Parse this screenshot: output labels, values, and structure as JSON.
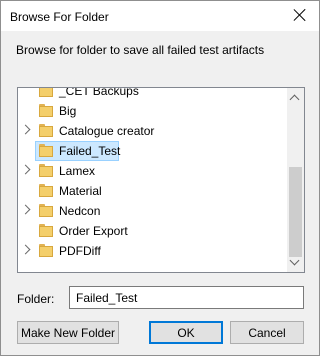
{
  "dialog": {
    "title": "Browse For Folder",
    "description": "Browse for folder to save all failed test artifacts"
  },
  "tree": {
    "items": [
      {
        "label": "_CET Backups",
        "expandable": false,
        "selected": false
      },
      {
        "label": "Big",
        "expandable": false,
        "selected": false
      },
      {
        "label": "Catalogue creator",
        "expandable": true,
        "selected": false
      },
      {
        "label": "Failed_Test",
        "expandable": false,
        "selected": true
      },
      {
        "label": "Lamex",
        "expandable": true,
        "selected": false
      },
      {
        "label": "Material",
        "expandable": false,
        "selected": false
      },
      {
        "label": "Nedcon",
        "expandable": true,
        "selected": false
      },
      {
        "label": "Order Export",
        "expandable": false,
        "selected": false
      },
      {
        "label": "PDFDiff",
        "expandable": true,
        "selected": false
      }
    ]
  },
  "folder_field": {
    "label": "Folder:",
    "value": "Failed_Test"
  },
  "buttons": {
    "new_folder": "Make New Folder",
    "ok": "OK",
    "cancel": "Cancel"
  },
  "colors": {
    "selection_bg": "#cce8ff",
    "selection_border": "#99d1ff",
    "default_button_border": "#0078d7",
    "folder_yellow": "#f4cf6b"
  },
  "icons": {
    "close": "close-icon",
    "folder": "folder-icon",
    "expand": "chevron-right-icon"
  }
}
